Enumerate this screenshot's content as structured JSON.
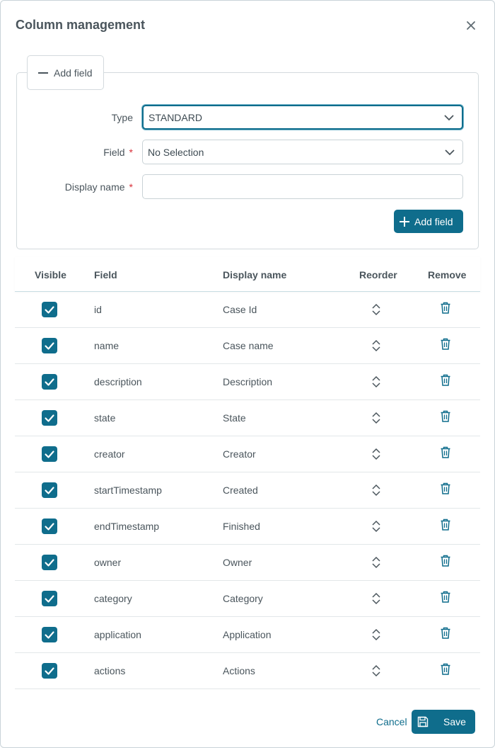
{
  "dialog": {
    "title": "Column management",
    "close_icon": "close-icon"
  },
  "add_section": {
    "toggle_label": "Add field",
    "type_label": "Type",
    "type_value": "STANDARD",
    "field_label": "Field",
    "field_value": "No Selection",
    "display_name_label": "Display name",
    "display_name_value": "",
    "required_mark": "*",
    "add_button_label": "Add field"
  },
  "table": {
    "headers": {
      "visible": "Visible",
      "field": "Field",
      "display_name": "Display name",
      "reorder": "Reorder",
      "remove": "Remove"
    },
    "rows": [
      {
        "visible": true,
        "field": "id",
        "display_name": "Case Id"
      },
      {
        "visible": true,
        "field": "name",
        "display_name": "Case name"
      },
      {
        "visible": true,
        "field": "description",
        "display_name": "Description"
      },
      {
        "visible": true,
        "field": "state",
        "display_name": "State"
      },
      {
        "visible": true,
        "field": "creator",
        "display_name": "Creator"
      },
      {
        "visible": true,
        "field": "startTimestamp",
        "display_name": "Created"
      },
      {
        "visible": true,
        "field": "endTimestamp",
        "display_name": "Finished"
      },
      {
        "visible": true,
        "field": "owner",
        "display_name": "Owner"
      },
      {
        "visible": true,
        "field": "category",
        "display_name": "Category"
      },
      {
        "visible": true,
        "field": "application",
        "display_name": "Application"
      },
      {
        "visible": true,
        "field": "actions",
        "display_name": "Actions"
      }
    ]
  },
  "footer": {
    "cancel_label": "Cancel",
    "save_label": "Save"
  },
  "colors": {
    "primary": "#0f6d8c",
    "required": "#d9303a"
  }
}
